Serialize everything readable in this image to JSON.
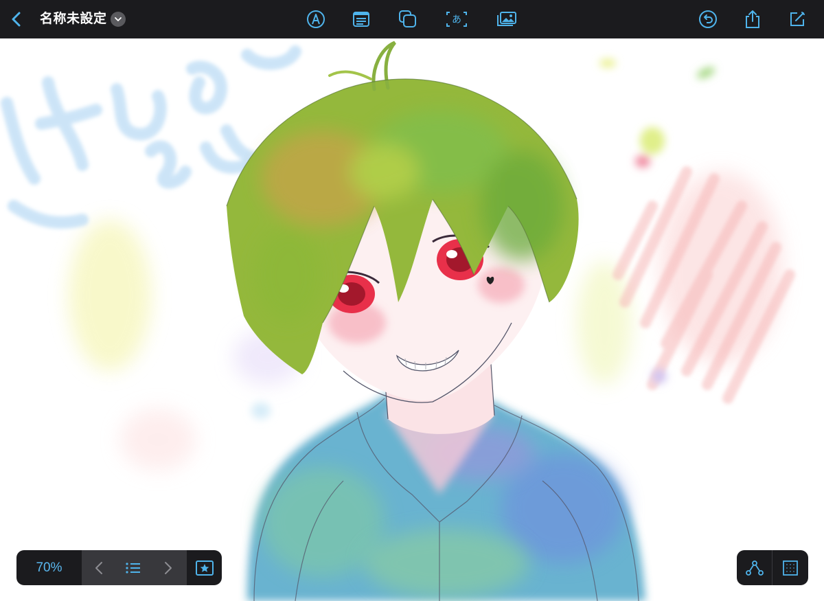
{
  "app": {
    "document_title": "名称未設定"
  },
  "toolbar": {
    "left": [
      {
        "icon": "chevron-left-icon"
      },
      {
        "icon": "chevron-down-icon"
      }
    ],
    "center": [
      {
        "icon": "pen-tool-icon"
      },
      {
        "icon": "text-lines-icon"
      },
      {
        "icon": "shapes-icon"
      },
      {
        "icon": "text-box-icon",
        "glyph": "あ"
      },
      {
        "icon": "image-insert-icon"
      }
    ],
    "right": [
      {
        "icon": "undo-icon"
      },
      {
        "icon": "share-icon"
      },
      {
        "icon": "compose-icon"
      }
    ]
  },
  "pager": {
    "zoom": "70%",
    "buttons": [
      "chevron-left-icon",
      "list-icon",
      "chevron-right-icon",
      "star-icon"
    ]
  },
  "right_controls": [
    "path-nodes-icon",
    "grid-icon"
  ],
  "colors": {
    "accent": "#4fb4ec",
    "bar": "#1b1b1e",
    "bar_mid": "#38383c"
  }
}
